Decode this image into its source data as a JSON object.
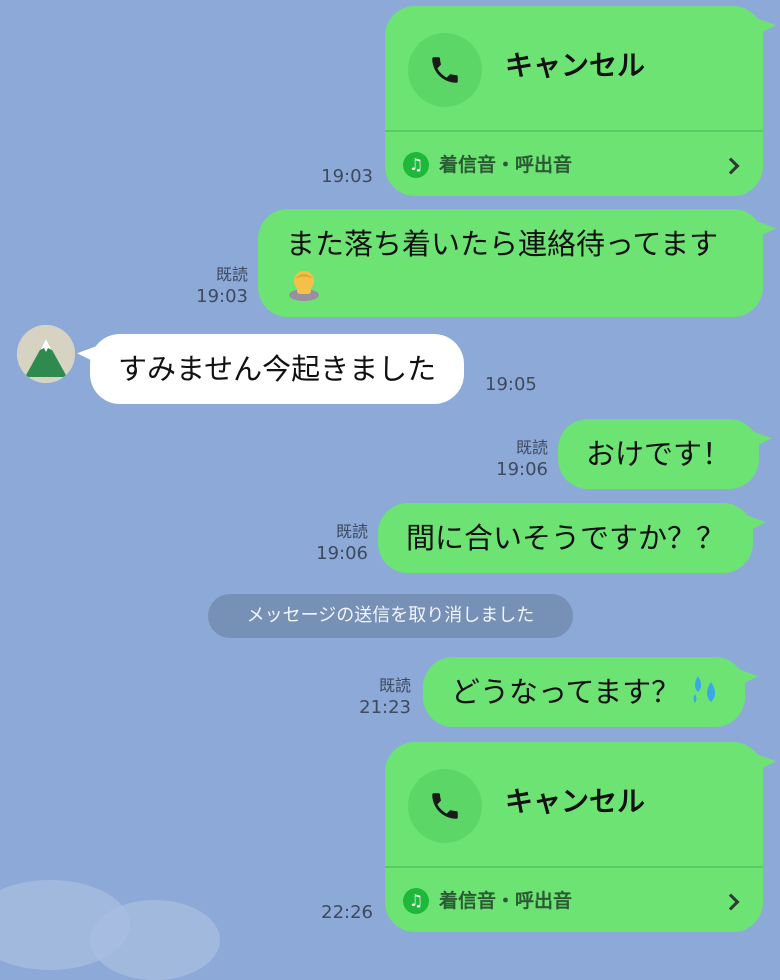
{
  "messages": [
    {
      "type": "call",
      "title": "キャンセル",
      "ringtone": "着信音・呼出音",
      "time": "19:03"
    },
    {
      "type": "text",
      "text": "また落ち着いたら連絡待ってます",
      "emoji": "bowing-person",
      "read": "既読",
      "time": "19:03"
    },
    {
      "type": "incoming",
      "text": "すみません今起きました",
      "time": "19:05"
    },
    {
      "type": "text",
      "text": "おけです！",
      "read": "既読",
      "time": "19:06"
    },
    {
      "type": "text",
      "text": "間に合いそうですか？？",
      "read": "既読",
      "time": "19:06"
    },
    {
      "type": "notice",
      "text": "メッセージの送信を取り消しました"
    },
    {
      "type": "text",
      "text": "どうなってます？",
      "emoji": "sweat-droplets",
      "read": "既読",
      "time": "21:23"
    },
    {
      "type": "call",
      "title": "キャンセル",
      "ringtone": "着信音・呼出音",
      "time": "22:26"
    }
  ],
  "icons": {
    "phone": "phone-icon",
    "music": "music-note-icon",
    "chevron": "chevron-right-icon",
    "avatar": "mountain-avatar"
  },
  "colors": {
    "background": "#8ca9d7",
    "outgoing_bubble": "#6de374",
    "incoming_bubble": "#ffffff",
    "notice_bg": "#7790b5"
  }
}
